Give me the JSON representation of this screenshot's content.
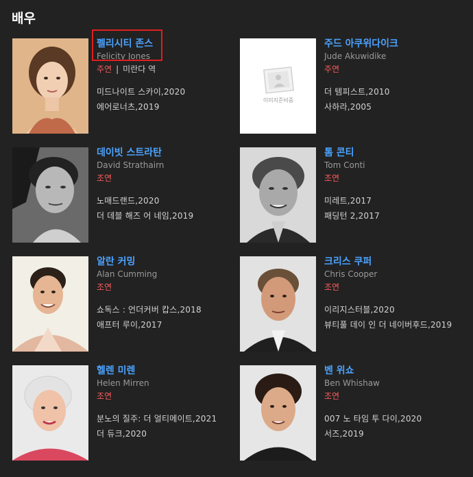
{
  "section": {
    "title": "배우"
  },
  "cast": [
    {
      "name": "펠리시티 존스",
      "eng": "Felicity Jones",
      "role": "주연",
      "character": "미란다 역",
      "works": [
        "미드나이트 스카이,2020",
        "에어로너츠,2019"
      ]
    },
    {
      "name": "주드 아쿠위다이크",
      "eng": "Jude Akuwidike",
      "role": "주연",
      "character": "",
      "placeholder_text": "이미지준비중",
      "works": [
        "더 템피스트,2010",
        "사하라,2005"
      ]
    },
    {
      "name": "데이빗 스트라탄",
      "eng": "David Strathairn",
      "role": "조연",
      "character": "",
      "works": [
        "노매드랜드,2020",
        "더 데블 해즈 어 네임,2019"
      ]
    },
    {
      "name": "톰 콘티",
      "eng": "Tom Conti",
      "role": "조연",
      "character": "",
      "works": [
        "미레트,2017",
        "패딩턴 2,2017"
      ]
    },
    {
      "name": "알란 커밍",
      "eng": "Alan Cumming",
      "role": "조연",
      "character": "",
      "works": [
        "쇼독스 : 언더커버 캅스,2018",
        "애프터 루이,2017"
      ]
    },
    {
      "name": "크리스 쿠퍼",
      "eng": "Chris Cooper",
      "role": "조연",
      "character": "",
      "works": [
        "이리지스터블,2020",
        "뷰티풀 데이 인 더 네이버후드,2019"
      ]
    },
    {
      "name": "헬렌 미렌",
      "eng": "Helen Mirren",
      "role": "조연",
      "character": "",
      "works": [
        "분노의 질주: 더 얼티메이트,2021",
        "더 듀크,2020"
      ]
    },
    {
      "name": "벤 위쇼",
      "eng": "Ben Whishaw",
      "role": "조연",
      "character": "",
      "works": [
        "007 노 타임 투 다이,2020",
        "서즈,2019"
      ]
    }
  ],
  "colors": {
    "background": "#222222",
    "name": "#4ba3ff",
    "role": "#ff5b5b",
    "highlight": "#e31e1e"
  }
}
